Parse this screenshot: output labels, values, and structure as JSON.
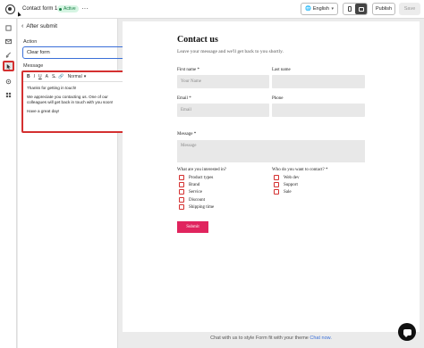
{
  "topbar": {
    "form_title": "Contact form 1",
    "status_badge": "Active",
    "language": "English",
    "publish_label": "Publish",
    "save_label": "Save"
  },
  "panel": {
    "header": "After submit",
    "action_label": "Action",
    "action_value": "Clear form",
    "message_label": "Message",
    "editor_format": "Normal",
    "editor_lines": [
      "Thanks for getting in touch!",
      "We appreciate you contacting us. One of our colleagues will get back in touch with you soon!",
      "Have a great day!"
    ]
  },
  "form": {
    "title": "Contact us",
    "subtitle": "Leave your message and we'll get back to you shortly.",
    "first_name_label": "First name *",
    "first_name_placeholder": "Your Name",
    "last_name_label": "Last name",
    "email_label": "Email *",
    "email_placeholder": "Email",
    "phone_label": "Phone",
    "message_label": "Message *",
    "message_placeholder": "Message",
    "interests_label": "What are you interested in?",
    "interests": [
      "Product types",
      "Brand",
      "Service",
      "Discount",
      "Shipping time"
    ],
    "contact_label": "Who do you want to contact? *",
    "contacts": [
      "Web dev",
      "Support",
      "Sale"
    ],
    "submit_label": "Submit"
  },
  "footer": {
    "note": "Chat with us to style Form fit with your theme",
    "link": "Chat now."
  },
  "colors": {
    "accent_blue": "#3a6fd8",
    "highlight_red": "#d43030",
    "submit_pink": "#e0245e",
    "active_green": "#1a7f46"
  }
}
